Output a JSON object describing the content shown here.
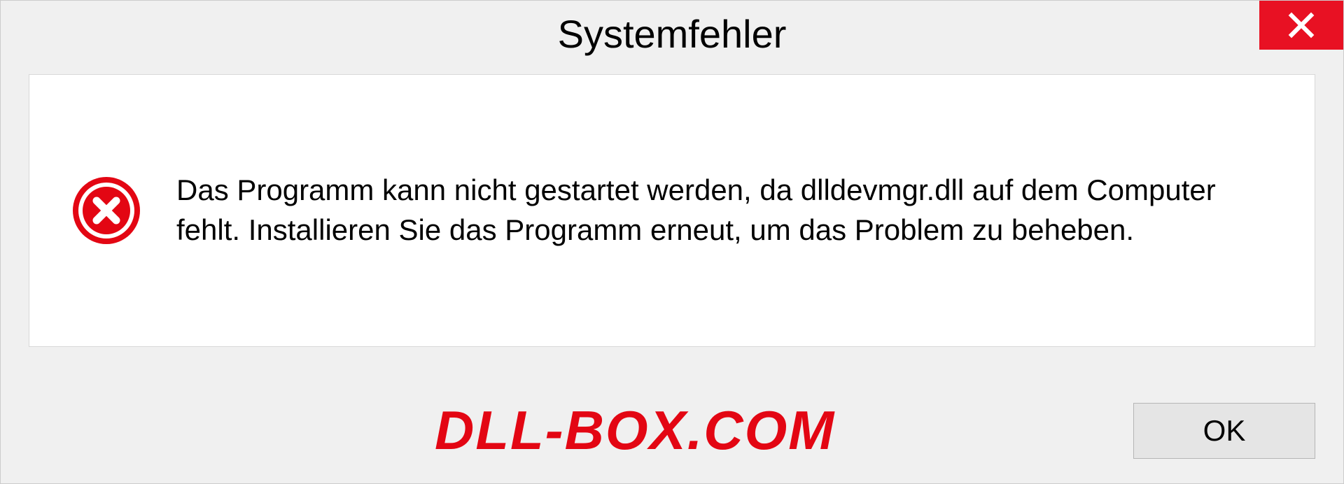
{
  "dialog": {
    "title": "Systemfehler",
    "message": "Das Programm kann nicht gestartet werden, da dlldevmgr.dll auf dem Computer fehlt. Installieren Sie das Programm erneut, um das Problem zu beheben.",
    "ok_label": "OK"
  },
  "watermark": "DLL-BOX.COM"
}
